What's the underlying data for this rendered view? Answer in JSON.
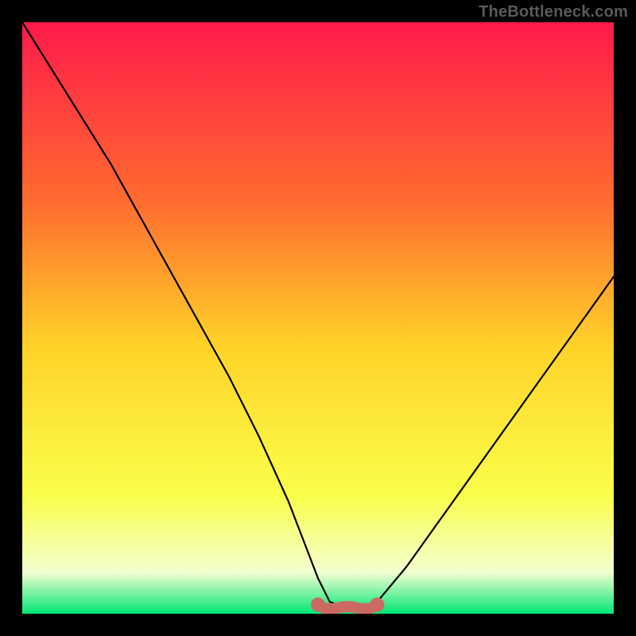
{
  "attribution": "TheBottleneck.com",
  "colors": {
    "frame": "#000000",
    "curve": "#000000",
    "accent": "#cb6a62",
    "gradient_top": "#ff1a4b",
    "gradient_mid_upper": "#ff6a2f",
    "gradient_mid": "#ffd328",
    "gradient_lower": "#faff4a",
    "gradient_pale": "#f3ffd0",
    "gradient_bottom": "#00e676"
  },
  "chart_data": {
    "type": "line",
    "title": "",
    "xlabel": "",
    "ylabel": "",
    "xlim": [
      0,
      100
    ],
    "ylim": [
      0,
      100
    ],
    "grid": false,
    "legend": false,
    "series": [
      {
        "name": "bottleneck-curve",
        "x": [
          0,
          5,
          10,
          15,
          20,
          25,
          30,
          35,
          40,
          45,
          50,
          52,
          55,
          58,
          60,
          65,
          70,
          75,
          80,
          85,
          90,
          95,
          100
        ],
        "values": [
          100,
          92,
          84,
          76,
          67,
          58,
          49,
          40,
          30,
          19,
          6,
          2,
          1,
          1,
          2,
          8,
          15,
          22,
          29,
          36,
          43,
          50,
          57
        ]
      }
    ],
    "accent_region": {
      "x_start": 50,
      "x_end": 60,
      "y": 1
    }
  }
}
